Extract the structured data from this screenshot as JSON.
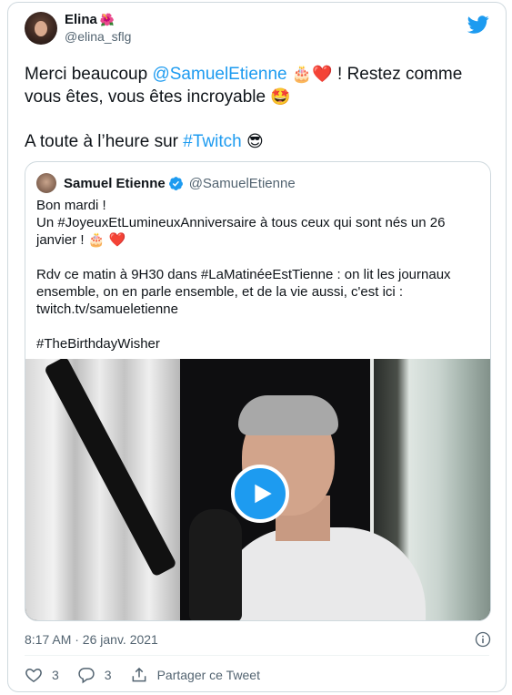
{
  "author": {
    "display_name": "Elina",
    "name_emoji": "🌺",
    "handle": "@elina_sflg",
    "avatar_icon": "avatar-photo"
  },
  "tweet": {
    "text_before": "Merci beaucoup ",
    "mention": "@SamuelEtienne",
    "emoji_1": "🎂❤️",
    "text_after": " ! Restez comme vous êtes, vous êtes incroyable ",
    "emoji_2": "🤩",
    "line2_before": "A toute à l’heure sur ",
    "hashtag": "#Twitch",
    "emoji_3": "😎"
  },
  "quoted": {
    "display_name": "Samuel Etienne",
    "handle": "@SamuelEtienne",
    "verified_icon": "verified-badge-icon",
    "line1": "Bon mardi !",
    "line2": "Un #JoyeuxEtLumineuxAnniversaire à tous ceux qui sont nés un 26 janvier ! 🎂 ❤️",
    "line3": "Rdv ce matin à 9H30 dans #LaMatinéeEstTienne : on lit les journaux ensemble, on en parle ensemble, et de la vie aussi, c'est ici : twitch.tv/samueletienne",
    "line4": "#TheBirthdayWisher"
  },
  "media": {
    "type": "video",
    "play_icon": "play-icon"
  },
  "meta": {
    "timestamp": "8:17 AM · 26 janv. 2021",
    "info_icon": "info-icon"
  },
  "actions": {
    "likes": "3",
    "replies": "3",
    "share_label": "Partager ce Tweet"
  },
  "colors": {
    "accent": "#1d9bf0",
    "text": "#0f1419",
    "muted": "#536471",
    "border": "#cfd9de"
  }
}
